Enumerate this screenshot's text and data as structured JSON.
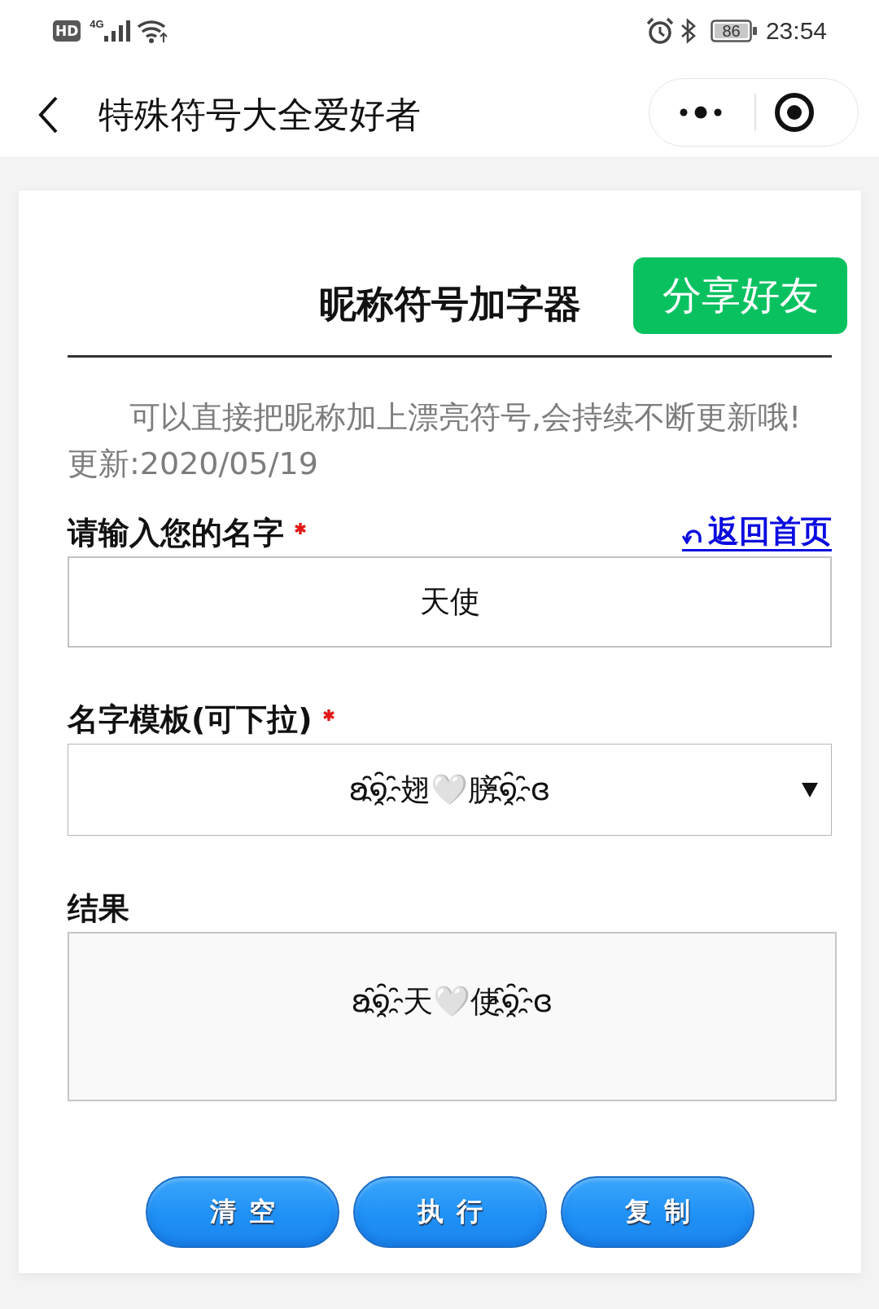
{
  "status_bar": {
    "hd": "HD",
    "network": "4G",
    "battery": "86",
    "time": "23:54"
  },
  "nav_bar": {
    "title": "特殊符号大全爱好者"
  },
  "card": {
    "title": "昵称符号加字器",
    "share_button": "分享好友",
    "description": "可以直接把昵称加上漂亮符号,会持续不断更新哦!",
    "updated": "更新:2020/05/19"
  },
  "fields": [
    {
      "kind": "input",
      "label": "请输入您的名字",
      "required": true,
      "link": "返回首页",
      "value": "天使"
    },
    {
      "kind": "select",
      "label": "名字模板(可下拉)",
      "required": true,
      "value": "ʚ໑҈翅🤍膀໑҈ɞ"
    },
    {
      "kind": "output",
      "label": "结果",
      "required": false,
      "value": "ʚ໑҈天🤍使໑҈ɞ"
    }
  ],
  "buttons": [
    "清空",
    "执行",
    "复制"
  ]
}
